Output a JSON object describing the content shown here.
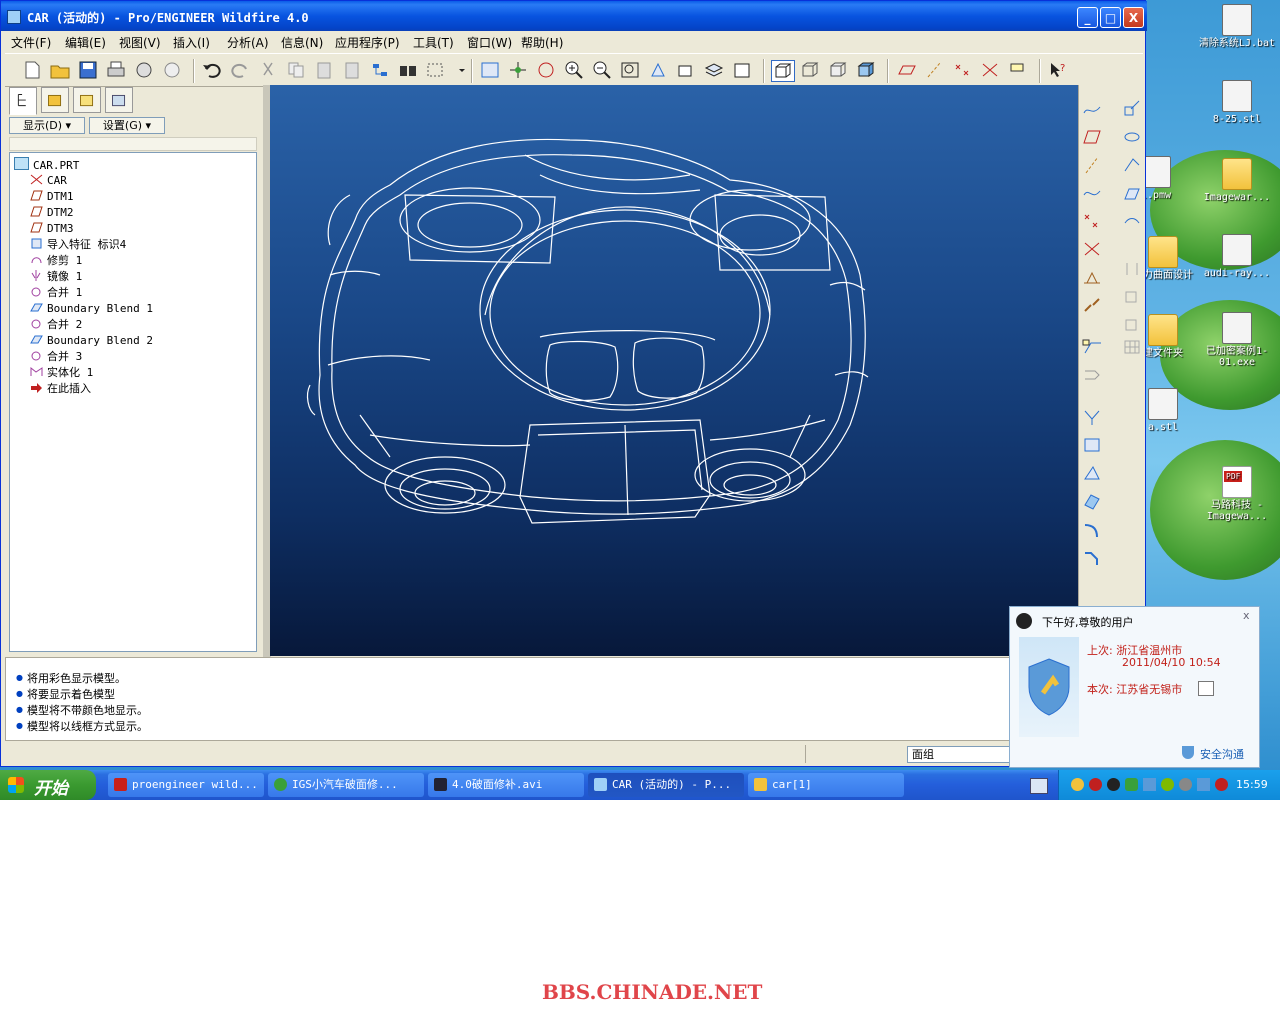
{
  "window": {
    "title": "CAR (活动的) - Pro/ENGINEER Wildfire 4.0",
    "controls": {
      "minimize": "_",
      "maximize": "□",
      "close": "X"
    }
  },
  "menubar": [
    "文件(F)",
    "编辑(E)",
    "视图(V)",
    "插入(I)",
    "分析(A)",
    "信息(N)",
    "应用程序(P)",
    "工具(T)",
    "窗口(W)",
    "帮助(H)"
  ],
  "left_panel": {
    "show_button": "显示(D)",
    "settings_button": "设置(G)",
    "tree": [
      {
        "label": "CAR.PRT",
        "icon": "part-icon",
        "level": 0
      },
      {
        "label": "CAR",
        "icon": "csys-icon",
        "level": 1
      },
      {
        "label": "DTM1",
        "icon": "datum-plane-icon",
        "level": 1
      },
      {
        "label": "DTM2",
        "icon": "datum-plane-icon",
        "level": 1
      },
      {
        "label": "DTM3",
        "icon": "datum-plane-icon",
        "level": 1
      },
      {
        "label": "导入特征 标识4",
        "icon": "import-icon",
        "level": 1
      },
      {
        "label": "修剪 1",
        "icon": "trim-icon",
        "level": 1
      },
      {
        "label": "镜像 1",
        "icon": "mirror-icon",
        "level": 1
      },
      {
        "label": "合并 1",
        "icon": "merge-icon",
        "level": 1
      },
      {
        "label": "Boundary Blend 1",
        "icon": "boundary-blend-icon",
        "level": 1
      },
      {
        "label": "合并 2",
        "icon": "merge-icon",
        "level": 1
      },
      {
        "label": "Boundary Blend 2",
        "icon": "boundary-blend-icon",
        "level": 1
      },
      {
        "label": "合并 3",
        "icon": "merge-icon",
        "level": 1
      },
      {
        "label": "实体化 1",
        "icon": "solidify-icon",
        "level": 1
      },
      {
        "label": "在此插入",
        "icon": "insert-here-arrow-icon",
        "level": 1
      }
    ]
  },
  "messages": [
    "将用彩色显示模型。",
    "将要显示着色模型",
    "模型将不带颜色地显示。",
    "模型将以线框方式显示。"
  ],
  "status": {
    "filter_value": "面组"
  },
  "qq_popup": {
    "title": "下午好,尊敬的用户",
    "close": "x",
    "last_label": "上次:",
    "last_location": "浙江省温州市",
    "last_time": "2011/04/10 10:54",
    "current_label": "本次:",
    "current_location": "江苏省无锡市",
    "link": "安全沟通"
  },
  "desktop_icons": [
    {
      "label": "清除系统LJ.bat",
      "kind": "file"
    },
    {
      "label": "8-25.stl",
      "kind": "file"
    },
    {
      "label": "l.pmw",
      "kind": "file"
    },
    {
      "label": "Imagewar...",
      "kind": "folder"
    },
    {
      "label": "魅力曲面设计",
      "kind": "folder"
    },
    {
      "label": "audi-ray...",
      "kind": "file"
    },
    {
      "label": "建文件夹",
      "kind": "folder"
    },
    {
      "label": "已加密案例1-01.exe",
      "kind": "file"
    },
    {
      "label": "a.stl",
      "kind": "file"
    },
    {
      "label": "马路科技 - Imagewa...",
      "kind": "pdf"
    }
  ],
  "taskbar": {
    "start": "开始",
    "tasks": [
      "proengineer wild...",
      "IGS小汽车破面修...",
      "4.0破面修补.avi",
      "CAR (活动的) - P...",
      "car[1]"
    ],
    "active_task": 3,
    "clock": "15:59"
  },
  "watermark": "BBS.CHINADE.NET",
  "colors": {
    "titlebar": "#0854e0",
    "viewport_top": "#2a62a8",
    "viewport_bottom": "#07183a",
    "wireframe": "#ffffff",
    "qq_text": "#c2211a"
  }
}
